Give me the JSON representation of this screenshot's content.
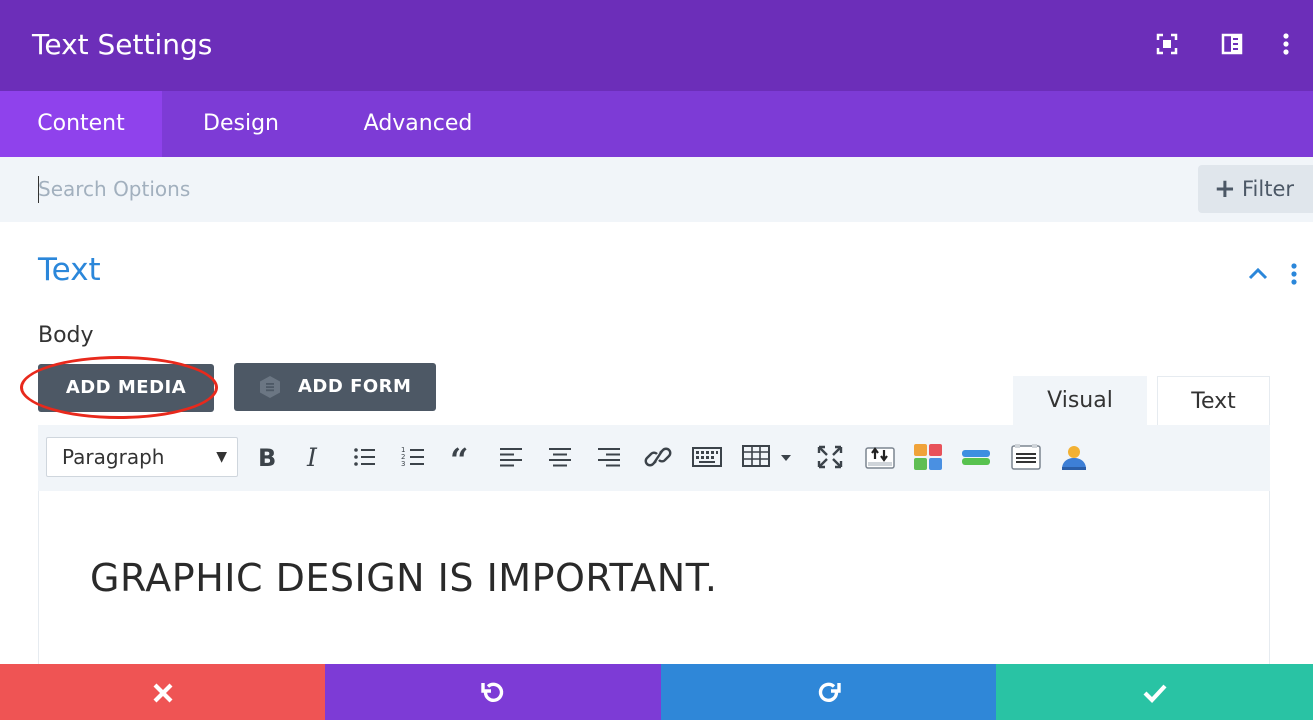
{
  "header": {
    "title": "Text Settings"
  },
  "tabs": [
    {
      "label": "Content",
      "active": true
    },
    {
      "label": "Design",
      "active": false
    },
    {
      "label": "Advanced",
      "active": false
    }
  ],
  "search": {
    "placeholder": "Search Options",
    "value": ""
  },
  "filter": {
    "label": "Filter"
  },
  "section": {
    "title": "Text"
  },
  "body_field": {
    "label": "Body"
  },
  "buttons": {
    "add_media": "ADD MEDIA",
    "add_form": "ADD FORM"
  },
  "editor_modes": {
    "visual": "Visual",
    "text": "Text",
    "active": "Visual"
  },
  "format_select": {
    "value": "Paragraph"
  },
  "toolbar_icons": [
    "bold-icon",
    "italic-icon",
    "bullet-list-icon",
    "numbered-list-icon",
    "blockquote-icon",
    "align-left-icon",
    "align-center-icon",
    "align-right-icon",
    "link-icon",
    "keyboard-icon",
    "table-icon",
    "fullscreen-icon",
    "upload-icon",
    "color-grid-icon",
    "layers-icon",
    "list-box-icon",
    "user-icon"
  ],
  "editor": {
    "content": "GRAPHIC DESIGN IS IMPORTANT."
  },
  "actions": [
    "close-icon",
    "undo-icon",
    "redo-icon",
    "check-icon"
  ],
  "colors": {
    "header_bg": "#6c2eb9",
    "tabs_bg": "#7d3bd6",
    "active_tab_bg": "#8f42ec",
    "accent_blue": "#2b87da",
    "close": "#ef5454",
    "undo": "#7d3bd6",
    "redo": "#2f87d8",
    "save": "#29c3a4",
    "highlight_ring": "#e8291c"
  }
}
